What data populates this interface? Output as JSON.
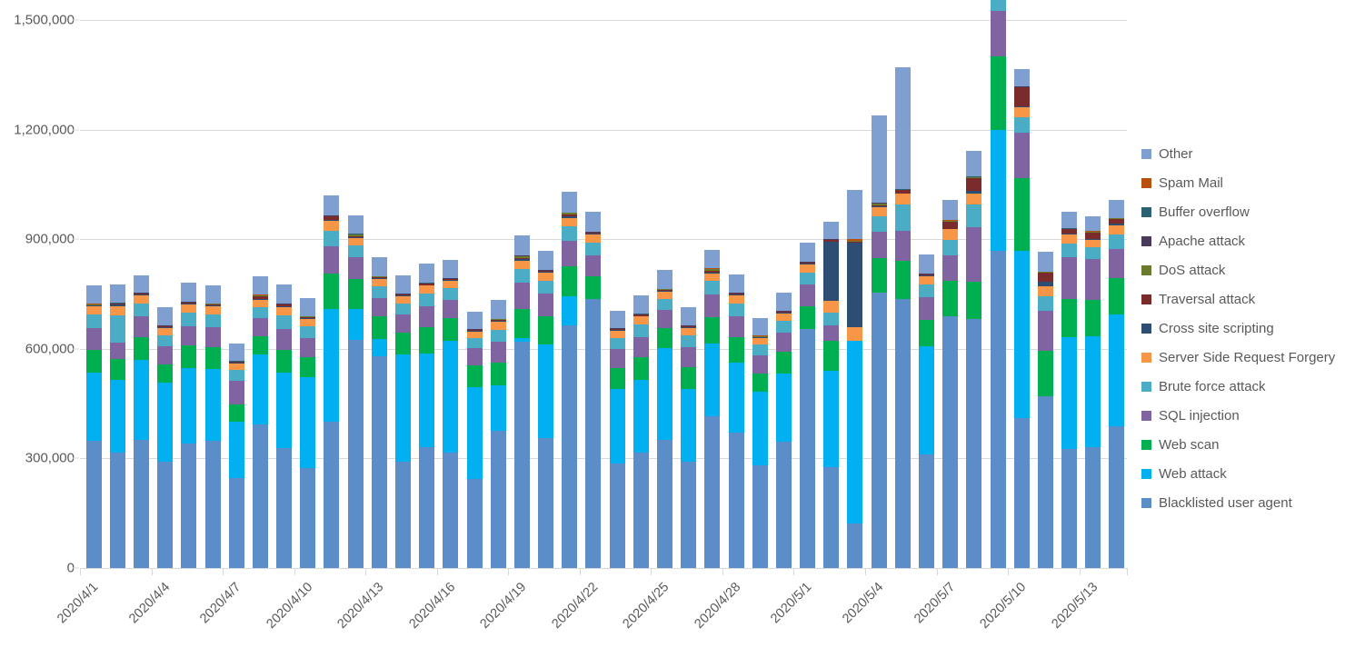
{
  "chart_data": {
    "type": "bar",
    "stacked": true,
    "title": "",
    "subtitle": "",
    "xlabel": "",
    "ylabel": "",
    "ylim": [
      0,
      1500000
    ],
    "ytick_labels": [
      "0",
      "300,000",
      "600,000",
      "900,000",
      "1,200,000",
      "1,500,000"
    ],
    "ytick_values": [
      0,
      300000,
      600000,
      900000,
      1200000,
      1500000
    ],
    "grid": true,
    "legend_position": "right",
    "x_tick_labels": [
      "2020/4/1",
      "2020/4/4",
      "2020/4/7",
      "2020/4/10",
      "2020/4/13",
      "2020/4/16",
      "2020/4/19",
      "2020/4/22",
      "2020/4/25",
      "2020/4/28",
      "2020/5/1",
      "2020/5/4",
      "2020/5/7",
      "2020/5/10",
      "2020/5/13"
    ],
    "x_tick_indices": [
      0,
      3,
      6,
      9,
      12,
      15,
      18,
      21,
      24,
      27,
      30,
      33,
      36,
      39,
      42
    ],
    "categories": [
      "2020/4/1",
      "2020/4/2",
      "2020/4/3",
      "2020/4/4",
      "2020/4/5",
      "2020/4/6",
      "2020/4/7",
      "2020/4/8",
      "2020/4/9",
      "2020/4/10",
      "2020/4/11",
      "2020/4/12",
      "2020/4/13",
      "2020/4/14",
      "2020/4/15",
      "2020/4/16",
      "2020/4/17",
      "2020/4/18",
      "2020/4/19",
      "2020/4/20",
      "2020/4/21",
      "2020/4/22",
      "2020/4/23",
      "2020/4/24",
      "2020/4/25",
      "2020/4/26",
      "2020/4/27",
      "2020/4/28",
      "2020/4/29",
      "2020/4/30",
      "2020/5/1",
      "2020/5/2",
      "2020/5/3",
      "2020/5/4",
      "2020/5/5",
      "2020/5/6",
      "2020/5/7",
      "2020/5/8",
      "2020/5/9",
      "2020/5/10",
      "2020/5/11",
      "2020/5/12",
      "2020/5/13",
      "2020/5/14"
    ],
    "series": [
      {
        "name": "Blacklisted user agent",
        "color": "#5B8DC8",
        "values": [
          348000,
          316000,
          350000,
          291000,
          342000,
          348000,
          247000,
          392000,
          328000,
          273000,
          400000,
          625000,
          580000,
          290000,
          332000,
          316000,
          244000,
          375000,
          620000,
          356000,
          665000,
          737000,
          285000,
          315000,
          352000,
          290000,
          415000,
          370000,
          280000,
          347000,
          655000,
          275000,
          123000,
          753000,
          737000,
          312000,
          690000,
          682000,
          867000,
          410000,
          470000,
          327000,
          330000,
          388000
        ]
      },
      {
        "name": "Web attack",
        "color": "#00B0F0",
        "values": [
          188000,
          200000,
          220000,
          217000,
          206000,
          196000,
          153000,
          193000,
          206000,
          250000,
          310000,
          85000,
          46000,
          294000,
          255000,
          306000,
          250000,
          124000,
          10000,
          255000,
          78000,
          0,
          205000,
          200000,
          250000,
          200000,
          200000,
          192000,
          203000,
          185000,
          0,
          265000,
          498000,
          0,
          0,
          296000,
          0,
          0,
          333000,
          458000,
          0,
          305000,
          305000,
          306000
        ]
      },
      {
        "name": "Web scan",
        "color": "#00B050",
        "values": [
          62000,
          55000,
          62000,
          50000,
          62000,
          60000,
          47000,
          50000,
          62000,
          55000,
          95000,
          80000,
          62000,
          60000,
          72000,
          62000,
          60000,
          62000,
          80000,
          78000,
          82000,
          62000,
          58000,
          62000,
          55000,
          60000,
          72000,
          70000,
          50000,
          60000,
          62000,
          82000,
          0,
          95000,
          105000,
          72000,
          95000,
          102000,
          200000,
          198000,
          125000,
          105000,
          100000,
          100000
        ]
      },
      {
        "name": "SQL injection",
        "color": "#8064A2",
        "values": [
          58000,
          45000,
          58000,
          50000,
          52000,
          55000,
          65000,
          48000,
          58000,
          52000,
          75000,
          60000,
          52000,
          50000,
          58000,
          50000,
          48000,
          58000,
          70000,
          62000,
          70000,
          58000,
          52000,
          55000,
          50000,
          55000,
          62000,
          58000,
          48000,
          52000,
          58000,
          42000,
          0,
          72000,
          80000,
          62000,
          72000,
          150000,
          125000,
          125000,
          110000,
          115000,
          110000,
          80000
        ]
      },
      {
        "name": "Brute force attack",
        "color": "#4BACC6",
        "values": [
          38000,
          75000,
          35000,
          30000,
          38000,
          36000,
          30000,
          32000,
          38000,
          32000,
          42000,
          32000,
          32000,
          30000,
          34000,
          32000,
          28000,
          34000,
          38000,
          35000,
          40000,
          34000,
          30000,
          34000,
          30000,
          32000,
          36000,
          34000,
          30000,
          32000,
          34000,
          35000,
          0,
          42000,
          72000,
          34000,
          42000,
          62000,
          42000,
          42000,
          40000,
          35000,
          32000,
          40000
        ]
      },
      {
        "name": "Server Side Request Forgery",
        "color": "#F79646",
        "values": [
          22000,
          25000,
          22000,
          20000,
          22000,
          22000,
          18000,
          20000,
          22000,
          20000,
          28000,
          22000,
          20000,
          20000,
          22000,
          20000,
          18000,
          22000,
          24000,
          22000,
          24000,
          22000,
          20000,
          22000,
          20000,
          20000,
          22000,
          22000,
          18000,
          20000,
          22000,
          32000,
          38000,
          26000,
          30000,
          22000,
          28000,
          30000,
          28000,
          28000,
          26000,
          25000,
          22000,
          25000
        ]
      },
      {
        "name": "Cross site scripting",
        "color": "#2D4D72",
        "values": [
          2000,
          5000,
          2000,
          2000,
          2000,
          2000,
          2000,
          2000,
          2000,
          2000,
          4000,
          2000,
          2000,
          2000,
          2000,
          2000,
          2000,
          2000,
          3000,
          2000,
          3000,
          2000,
          2000,
          2000,
          2000,
          2000,
          2000,
          2000,
          2000,
          2000,
          2000,
          162000,
          232000,
          2000,
          2000,
          2000,
          2000,
          6000,
          8000,
          2000,
          12000,
          3000,
          2000,
          3000
        ]
      },
      {
        "name": "Traversal attack",
        "color": "#7B2B2B",
        "values": [
          2000,
          2000,
          2000,
          2000,
          2000,
          3000,
          2000,
          8000,
          5000,
          3000,
          8000,
          2000,
          3000,
          3000,
          3000,
          3000,
          2000,
          3000,
          4000,
          3000,
          5000,
          3000,
          2000,
          3000,
          3000,
          3000,
          4000,
          3000,
          2000,
          3000,
          3000,
          5000,
          3000,
          3000,
          8000,
          3000,
          20000,
          35000,
          68000,
          52000,
          26000,
          12000,
          18000,
          14000
        ]
      },
      {
        "name": "DoS attack",
        "color": "#6A7C2B",
        "values": [
          1000,
          1000,
          1000,
          1000,
          1000,
          1000,
          1000,
          1000,
          1000,
          1000,
          2000,
          5000,
          1000,
          1000,
          1000,
          1000,
          1000,
          1000,
          5000,
          1000,
          5000,
          1000,
          1000,
          1000,
          1000,
          1000,
          5000,
          1000,
          1000,
          1000,
          1000,
          1000,
          1000,
          5000,
          1000,
          1000,
          1000,
          3000,
          5000,
          2000,
          1000,
          1000,
          1000,
          1000
        ]
      },
      {
        "name": "Apache attack",
        "color": "#4A3A5C",
        "values": [
          1000,
          1000,
          1000,
          1000,
          1000,
          1000,
          1000,
          1000,
          1000,
          1000,
          1000,
          1000,
          1000,
          1000,
          1000,
          1000,
          1000,
          1000,
          1000,
          1000,
          1000,
          1000,
          1000,
          1000,
          1000,
          1000,
          1000,
          1000,
          1000,
          1000,
          1000,
          1000,
          1000,
          1000,
          1000,
          1000,
          1000,
          1000,
          1000,
          1000,
          1000,
          1000,
          1000,
          1000
        ]
      },
      {
        "name": "Buffer overflow",
        "color": "#2A6173",
        "values": [
          500,
          500,
          500,
          500,
          500,
          500,
          500,
          500,
          500,
          500,
          500,
          500,
          500,
          500,
          500,
          500,
          500,
          500,
          500,
          500,
          500,
          500,
          500,
          500,
          500,
          500,
          500,
          500,
          500,
          500,
          500,
          500,
          500,
          500,
          500,
          500,
          500,
          500,
          500,
          500,
          500,
          500,
          500,
          500
        ]
      },
      {
        "name": "Spam Mail",
        "color": "#B8500B",
        "values": [
          500,
          500,
          500,
          500,
          500,
          500,
          500,
          500,
          500,
          500,
          500,
          500,
          500,
          500,
          500,
          500,
          500,
          500,
          500,
          500,
          500,
          500,
          500,
          500,
          500,
          500,
          500,
          500,
          500,
          500,
          500,
          500,
          3000,
          500,
          500,
          500,
          500,
          500,
          500,
          500,
          500,
          500,
          500,
          500
        ]
      },
      {
        "name": "Other",
        "color": "#7F9FD0",
        "values": [
          50000,
          50000,
          48000,
          50000,
          52000,
          50000,
          48000,
          50000,
          52000,
          50000,
          55000,
          50000,
          50000,
          50000,
          52000,
          50000,
          48000,
          52000,
          55000,
          52000,
          55000,
          55000,
          48000,
          50000,
          50000,
          50000,
          52000,
          50000,
          48000,
          50000,
          52000,
          48000,
          135000,
          240000,
          335000,
          52000,
          55000,
          70000,
          40000,
          48000,
          55000,
          45000,
          40000,
          48000
        ]
      }
    ]
  },
  "legend": {
    "items": [
      {
        "label": "Other",
        "color": "#7F9FD0"
      },
      {
        "label": "Spam Mail",
        "color": "#B8500B"
      },
      {
        "label": "Buffer overflow",
        "color": "#2A6173"
      },
      {
        "label": "Apache attack",
        "color": "#4A3A5C"
      },
      {
        "label": "DoS attack",
        "color": "#6A7C2B"
      },
      {
        "label": "Traversal attack",
        "color": "#7B2B2B"
      },
      {
        "label": "Cross site scripting",
        "color": "#2D4D72"
      },
      {
        "label": "Server Side Request Forgery",
        "color": "#F79646"
      },
      {
        "label": "Brute force attack",
        "color": "#4BACC6"
      },
      {
        "label": "SQL injection",
        "color": "#8064A2"
      },
      {
        "label": "Web scan",
        "color": "#00B050"
      },
      {
        "label": "Web attack",
        "color": "#00B0F0"
      },
      {
        "label": "Blacklisted user agent",
        "color": "#5B8DC8"
      }
    ]
  }
}
